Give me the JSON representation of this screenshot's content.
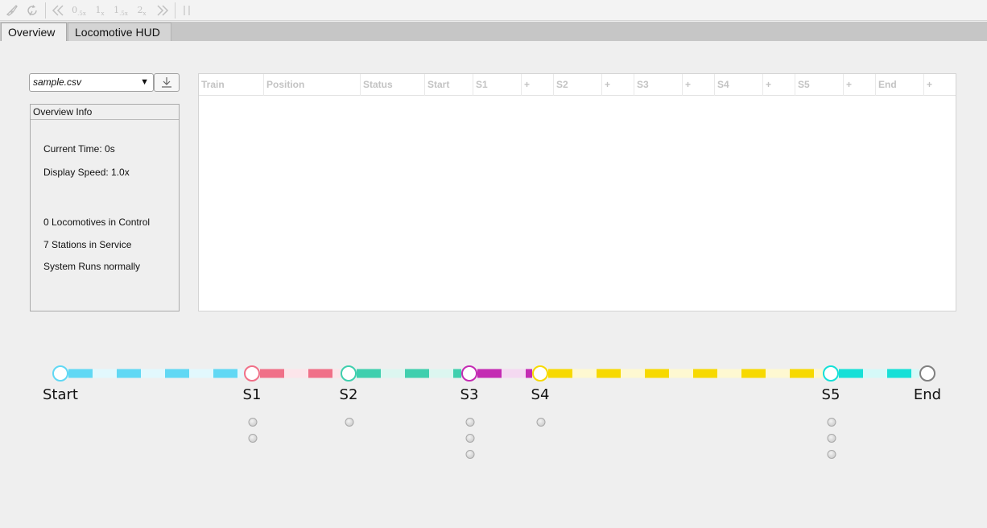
{
  "toolbar": {
    "speed_buttons": [
      {
        "main": "0",
        "sub": ".5x"
      },
      {
        "main": "1",
        "sub": "x"
      },
      {
        "main": "1",
        "sub": ".5x"
      },
      {
        "main": "2",
        "sub": "x"
      }
    ]
  },
  "tabs": [
    {
      "label": "Overview",
      "active": true
    },
    {
      "label": "Locomotive HUD",
      "active": false
    }
  ],
  "file_select": {
    "value": "sample.csv"
  },
  "overview_info": {
    "title": "Overview Info",
    "current_time": "Current Time: 0s",
    "display_speed": "Display Speed: 1.0x",
    "locomotives": "0 Locomotives in Control",
    "stations": "7 Stations in Service",
    "system_status": "System Runs normally"
  },
  "table": {
    "columns": [
      "Train",
      "Position",
      "Status",
      "Start",
      "S1",
      "+",
      "S2",
      "+",
      "S3",
      "+",
      "S4",
      "+",
      "S5",
      "+",
      "End",
      "+"
    ],
    "rows": []
  },
  "line": {
    "stations": [
      {
        "label": "Start",
        "color": "#60d8f4",
        "dots": 0
      },
      {
        "label": "S1",
        "color": "#f07088",
        "dots": 2
      },
      {
        "label": "S2",
        "color": "#3fcfae",
        "dots": 1
      },
      {
        "label": "S3",
        "color": "#c42bb3",
        "dots": 3
      },
      {
        "label": "S4",
        "color": "#f7d900",
        "dots": 1
      },
      {
        "label": "S5",
        "color": "#15e0d7",
        "dots": 3
      },
      {
        "label": "End",
        "color": "#808080",
        "dots": 0
      }
    ]
  }
}
